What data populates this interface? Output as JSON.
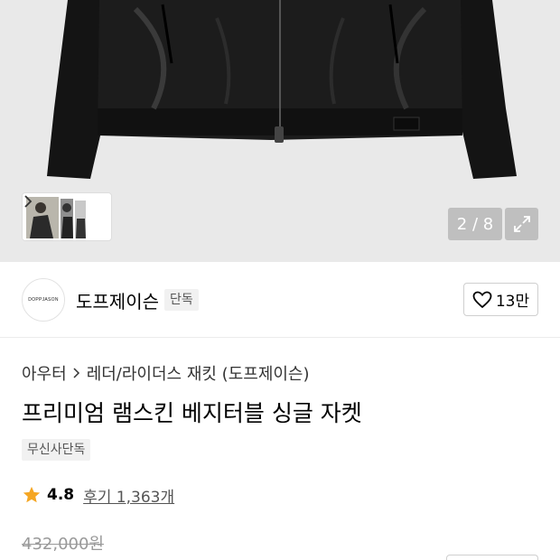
{
  "gallery": {
    "counter": "2 / 8",
    "icons": {
      "thumb_arrow": "chevron-right-icon",
      "expand": "expand-icon"
    }
  },
  "brand": {
    "logo_text": "DOPPJASON",
    "name": "도프제이슨",
    "badge": "단독",
    "likes": "13만",
    "like_icon": "heart-icon"
  },
  "product": {
    "breadcrumb": [
      "아우터",
      "레더/라이더스 재킷 (도프제이슨)"
    ],
    "title": "프리미엄 램스킨 베지터블 싱글 자켓",
    "tag": "무신사단독",
    "rating": "4.8",
    "reviews": "후기 1,363개",
    "original_price": "432,000원",
    "star_color": "#f5a623"
  }
}
